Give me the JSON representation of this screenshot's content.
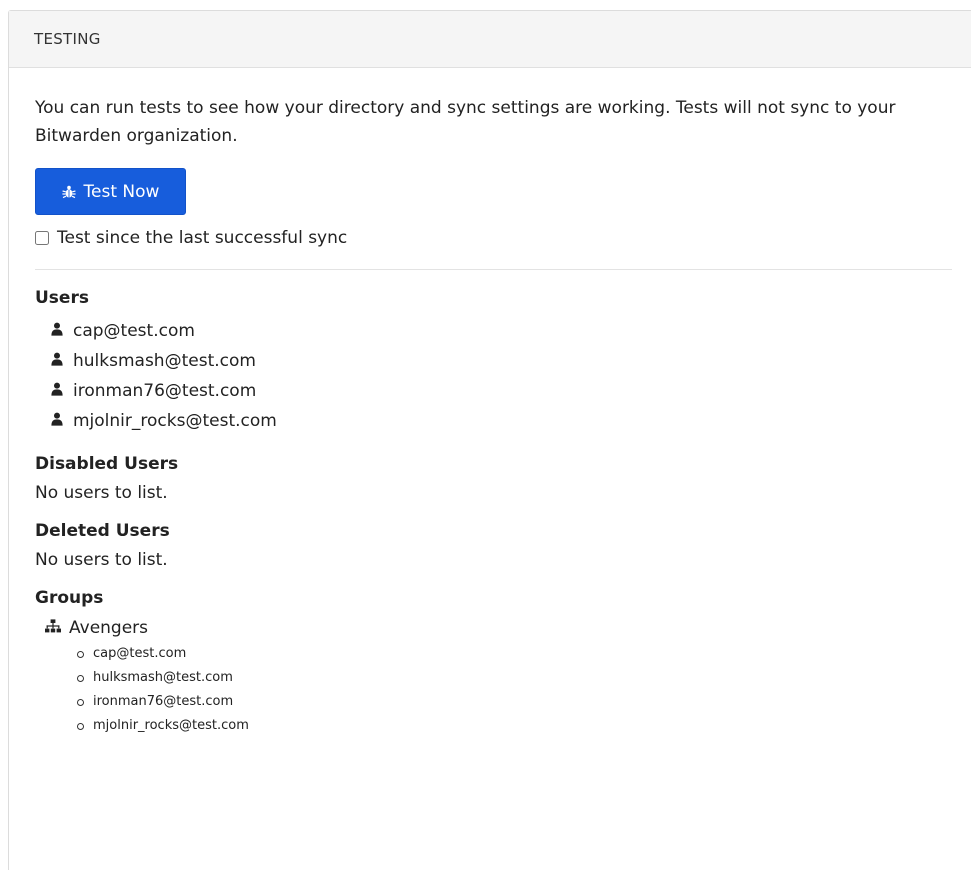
{
  "header": {
    "title": "TESTING"
  },
  "intro": {
    "text": "You can run tests to see how your directory and sync settings are working. Tests will not sync to your Bitwarden organization."
  },
  "test_button": {
    "label": "Test Now",
    "icon": "bug-icon",
    "color": "#175ddc"
  },
  "since_last_sync": {
    "label": "Test since the last successful sync",
    "checked": false
  },
  "users": {
    "title": "Users",
    "icon": "user-icon",
    "items": [
      "cap@test.com",
      "hulksmash@test.com",
      "ironman76@test.com",
      "mjolnir_rocks@test.com"
    ]
  },
  "disabled_users": {
    "title": "Disabled Users",
    "empty_text": "No users to list."
  },
  "deleted_users": {
    "title": "Deleted Users",
    "empty_text": "No users to list."
  },
  "groups": {
    "title": "Groups",
    "icon": "sitemap-icon",
    "items": [
      {
        "name": "Avengers",
        "members": [
          "cap@test.com",
          "hulksmash@test.com",
          "ironman76@test.com",
          "mjolnir_rocks@test.com"
        ]
      }
    ]
  }
}
